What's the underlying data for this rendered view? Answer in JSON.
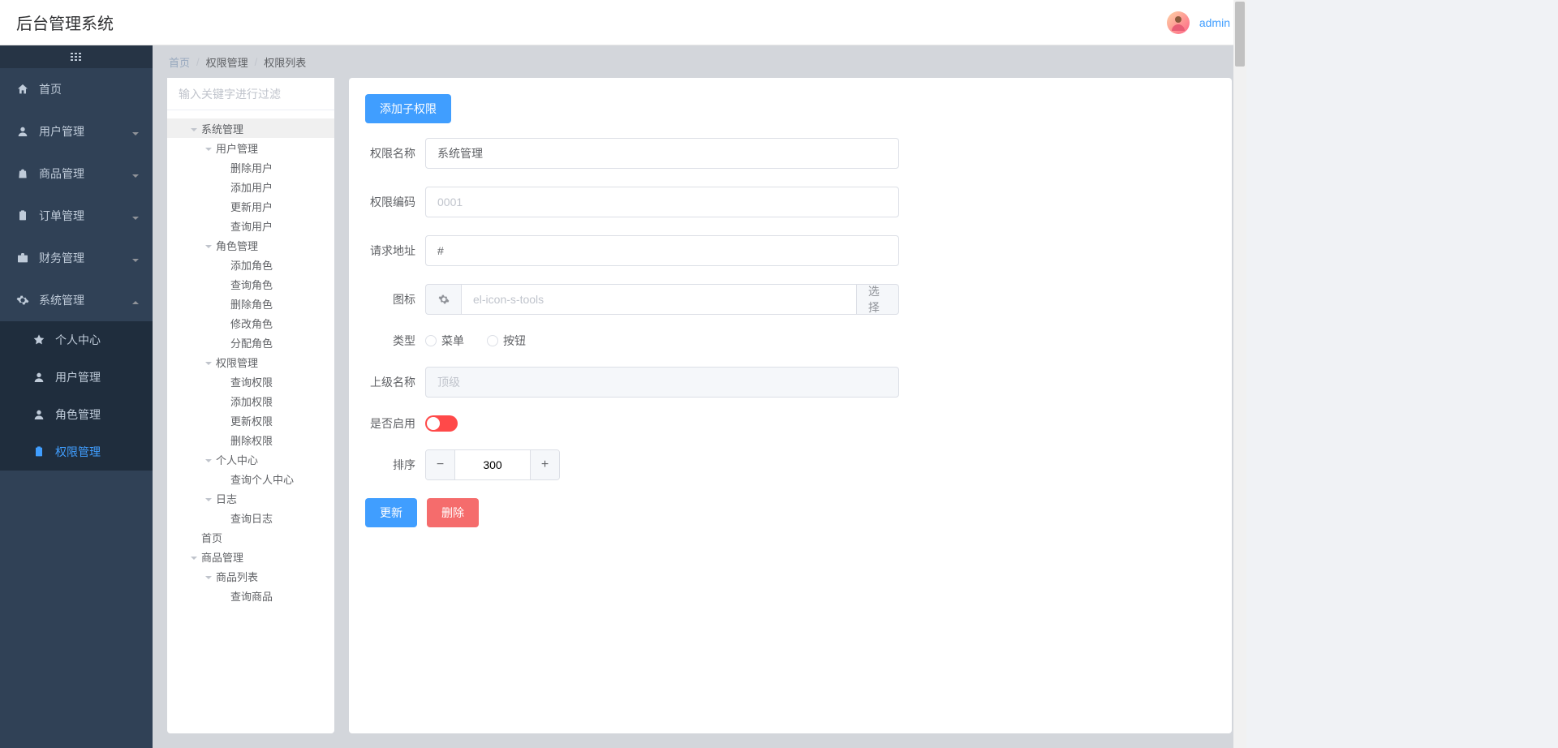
{
  "header": {
    "title": "后台管理系统",
    "username": "admin"
  },
  "sidebar": {
    "items": [
      {
        "label": "首页",
        "icon": "home",
        "expandable": false
      },
      {
        "label": "用户管理",
        "icon": "user",
        "expandable": true
      },
      {
        "label": "商品管理",
        "icon": "bag",
        "expandable": true
      },
      {
        "label": "订单管理",
        "icon": "clipboard",
        "expandable": true
      },
      {
        "label": "财务管理",
        "icon": "briefcase",
        "expandable": true
      },
      {
        "label": "系统管理",
        "icon": "gear",
        "expandable": true,
        "expanded": true,
        "children": [
          {
            "label": "个人中心",
            "icon": "star"
          },
          {
            "label": "用户管理",
            "icon": "person"
          },
          {
            "label": "角色管理",
            "icon": "person"
          },
          {
            "label": "权限管理",
            "icon": "clipboard",
            "active": true
          }
        ]
      }
    ]
  },
  "breadcrumb": {
    "items": [
      "首页",
      "权限管理",
      "权限列表"
    ]
  },
  "tree": {
    "filter_placeholder": "输入关键字进行过滤",
    "nodes": [
      {
        "label": "系统管理",
        "depth": 0,
        "caret": "open",
        "selected": true
      },
      {
        "label": "用户管理",
        "depth": 1,
        "caret": "open"
      },
      {
        "label": "删除用户",
        "depth": 2,
        "caret": "none"
      },
      {
        "label": "添加用户",
        "depth": 2,
        "caret": "none"
      },
      {
        "label": "更新用户",
        "depth": 2,
        "caret": "none"
      },
      {
        "label": "查询用户",
        "depth": 2,
        "caret": "none"
      },
      {
        "label": "角色管理",
        "depth": 1,
        "caret": "open"
      },
      {
        "label": "添加角色",
        "depth": 2,
        "caret": "none"
      },
      {
        "label": "查询角色",
        "depth": 2,
        "caret": "none"
      },
      {
        "label": "删除角色",
        "depth": 2,
        "caret": "none"
      },
      {
        "label": "修改角色",
        "depth": 2,
        "caret": "none"
      },
      {
        "label": "分配角色",
        "depth": 2,
        "caret": "none"
      },
      {
        "label": "权限管理",
        "depth": 1,
        "caret": "open"
      },
      {
        "label": "查询权限",
        "depth": 2,
        "caret": "none"
      },
      {
        "label": "添加权限",
        "depth": 2,
        "caret": "none"
      },
      {
        "label": "更新权限",
        "depth": 2,
        "caret": "none"
      },
      {
        "label": "删除权限",
        "depth": 2,
        "caret": "none"
      },
      {
        "label": "个人中心",
        "depth": 1,
        "caret": "open"
      },
      {
        "label": "查询个人中心",
        "depth": 2,
        "caret": "none"
      },
      {
        "label": "日志",
        "depth": 1,
        "caret": "open"
      },
      {
        "label": "查询日志",
        "depth": 2,
        "caret": "none"
      },
      {
        "label": "首页",
        "depth": 0,
        "caret": "none"
      },
      {
        "label": "商品管理",
        "depth": 0,
        "caret": "open"
      },
      {
        "label": "商品列表",
        "depth": 1,
        "caret": "open"
      },
      {
        "label": "查询商品",
        "depth": 2,
        "caret": "none"
      }
    ]
  },
  "form": {
    "add_child_label": "添加子权限",
    "name_label": "权限名称",
    "name_value": "系统管理",
    "code_label": "权限编码",
    "code_placeholder": "0001",
    "url_label": "请求地址",
    "url_value": "#",
    "icon_label": "图标",
    "icon_placeholder": "el-icon-s-tools",
    "icon_select_label": "选择",
    "type_label": "类型",
    "type_options": [
      "菜单",
      "按钮"
    ],
    "parent_label": "上级名称",
    "parent_placeholder": "顶级",
    "enable_label": "是否启用",
    "sort_label": "排序",
    "sort_value": "300",
    "update_label": "更新",
    "delete_label": "删除"
  }
}
